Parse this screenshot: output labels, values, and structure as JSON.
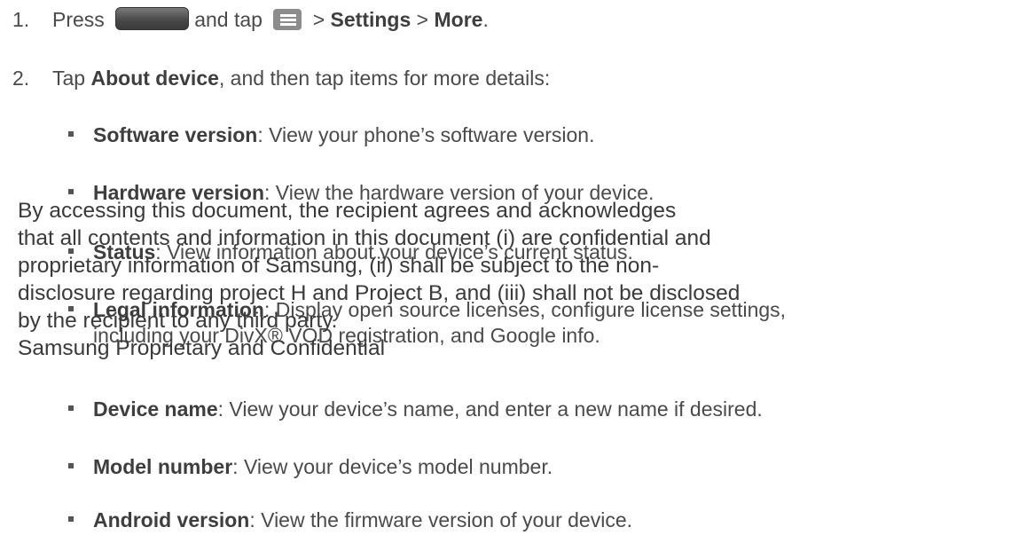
{
  "steps": [
    {
      "num": "1.",
      "parts": {
        "press": "Press",
        "and_tap": "and tap",
        "sep1": " > ",
        "settings": "Settings",
        "sep2": " > ",
        "more": "More",
        "end": "."
      },
      "icons": [
        "home-key",
        "menu-icon"
      ]
    },
    {
      "num": "2.",
      "parts": {
        "tap": "Tap ",
        "about": "About device",
        "rest": ", and then tap items for more details:"
      }
    }
  ],
  "items": [
    {
      "term": "Software version",
      "desc": ": View your phone’s software version."
    },
    {
      "term": "Hardware version",
      "desc": ": View the hardware version of your device."
    },
    {
      "term": "Status",
      "desc": ": View information about your device’s current status."
    },
    {
      "term": "Legal information",
      "desc": ": Display open source licenses, configure license settings,",
      "cont": "including your DivX® VOD registration, and Google info."
    },
    {
      "term": "Device name",
      "desc": ": View your device’s name, and enter a new name if desired."
    },
    {
      "term": "Model number",
      "desc": ": View your device’s model number."
    },
    {
      "term": "Android version",
      "desc": ": View the firmware version of your device."
    }
  ],
  "watermark": [
    "By accessing this document, the recipient agrees and acknowledges",
    "that all contents and information in this document (i) are confidential and",
    "proprietary information of Samsung, (ii) shall be subject to the non-",
    "disclosure regarding project H and Project B, and (iii) shall not be disclosed",
    "by the recipient to any third party.",
    "Samsung Proprietary and Confidential"
  ]
}
